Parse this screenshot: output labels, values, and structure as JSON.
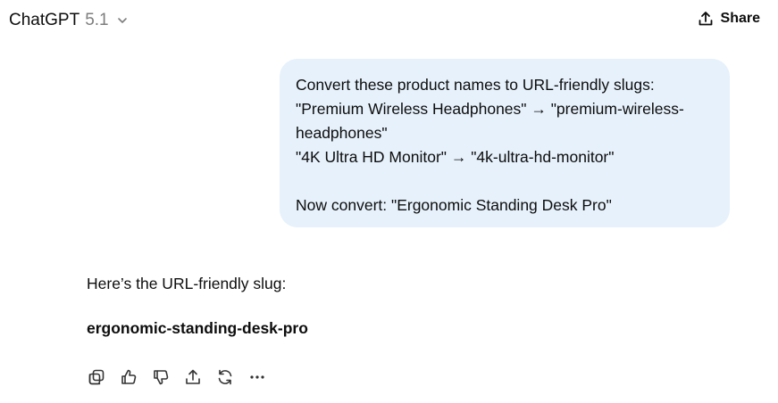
{
  "header": {
    "model_name": "ChatGPT",
    "model_version": "5.1",
    "share_label": "Share"
  },
  "conversation": {
    "user_message": {
      "lines": [
        "Convert these product names to URL-friendly slugs:",
        "\"Premium Wireless Headphones\" → \"premium-wireless-",
        "headphones\"",
        "\"4K Ultra HD Monitor\" → \"4k-ultra-hd-monitor\"",
        "",
        "Now convert: \"Ergonomic Standing Desk Pro\""
      ]
    },
    "assistant_message": {
      "intro": "Here’s the URL-friendly slug:",
      "slug": "ergonomic-standing-desk-pro"
    },
    "actions": [
      {
        "name": "copy-icon"
      },
      {
        "name": "thumbs-up-icon"
      },
      {
        "name": "thumbs-down-icon"
      },
      {
        "name": "share-icon"
      },
      {
        "name": "regenerate-icon"
      },
      {
        "name": "more-icon"
      }
    ]
  },
  "colors": {
    "user_bubble_bg": "#e6f1fb",
    "text": "#0d0d0d",
    "muted": "#7d7d7d"
  }
}
